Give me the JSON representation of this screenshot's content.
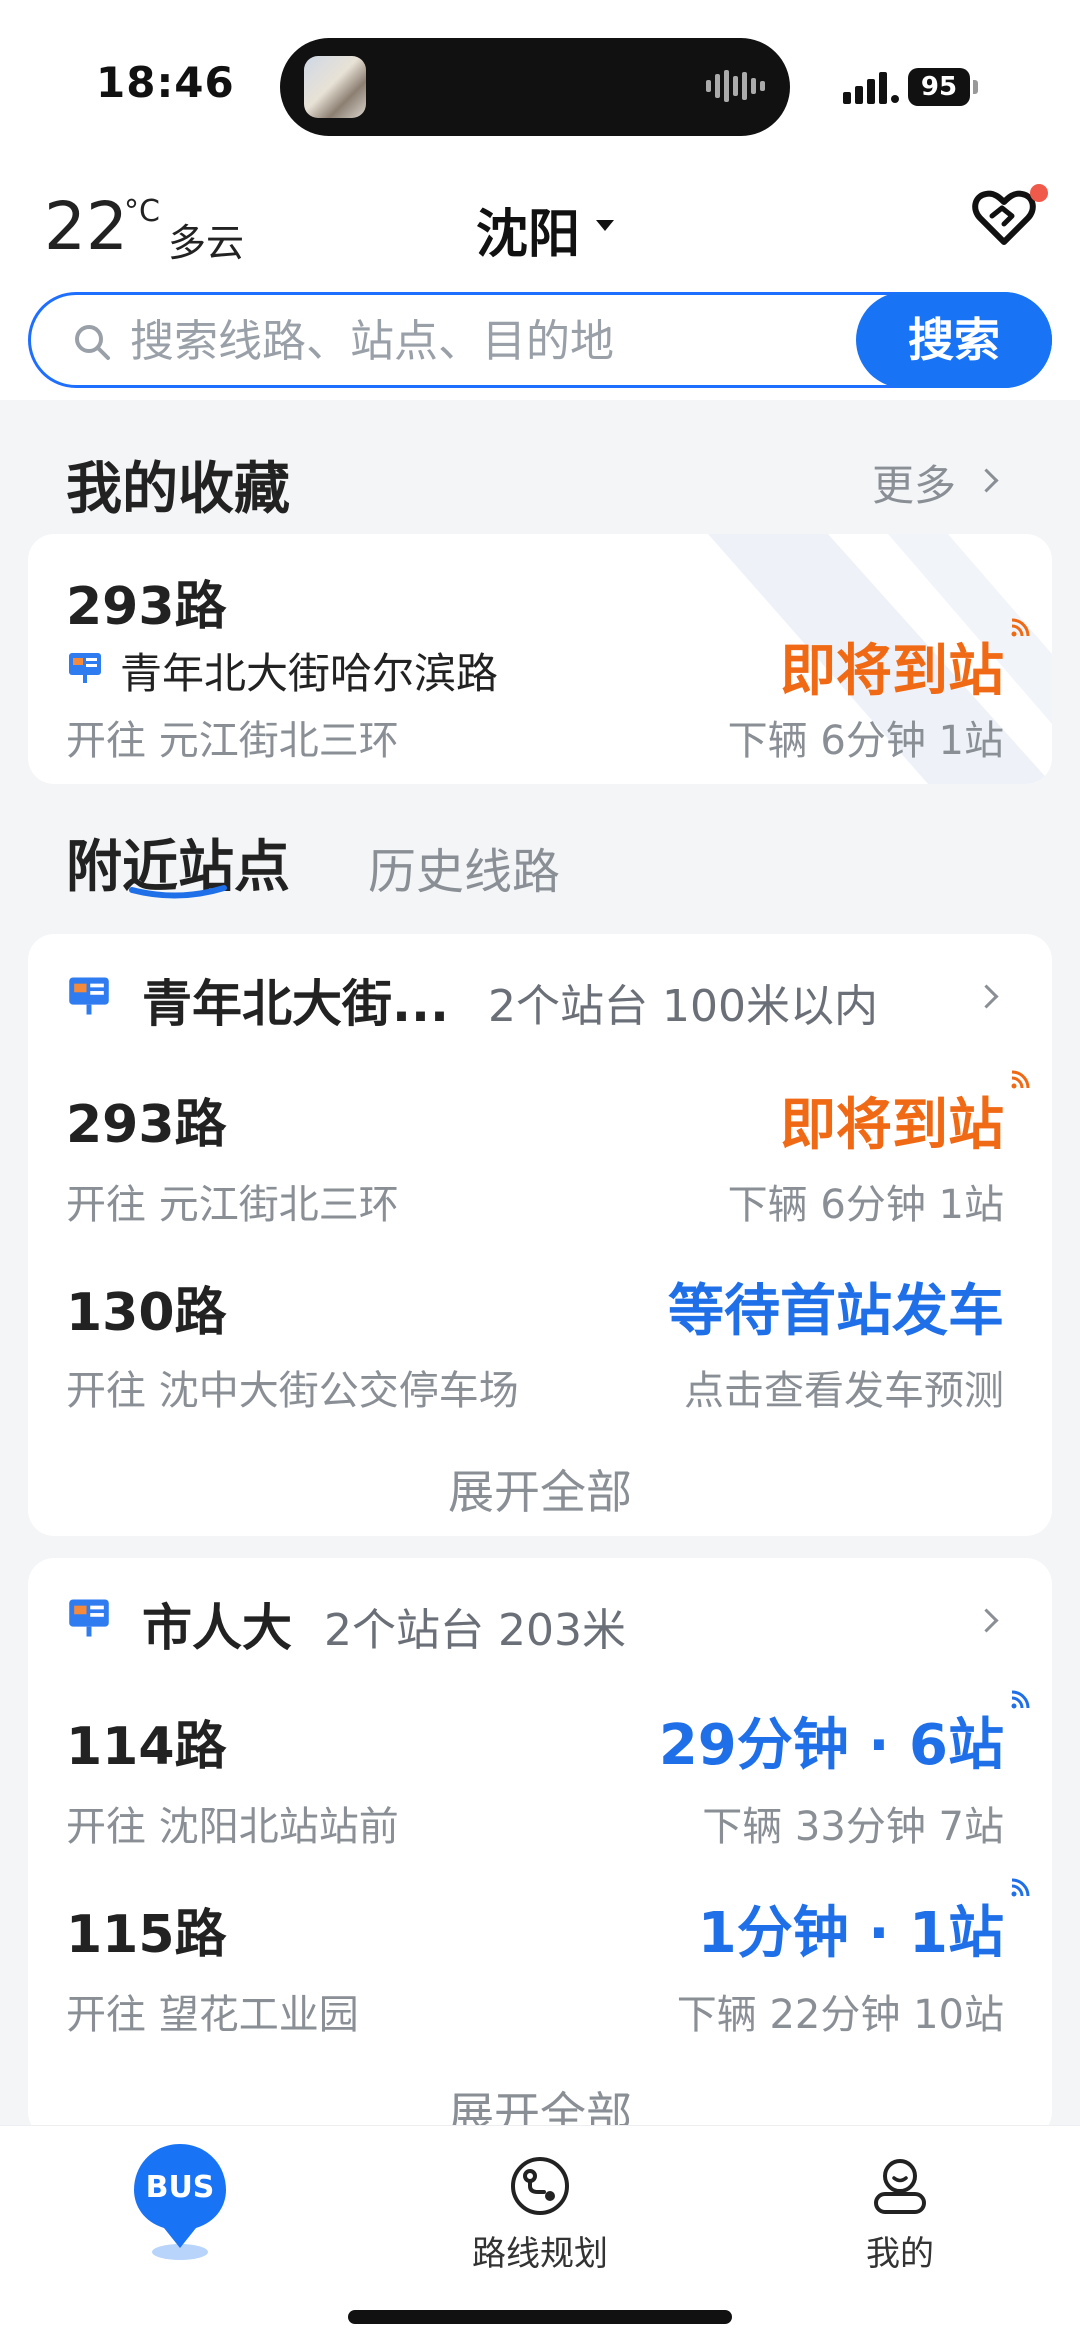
{
  "status_bar": {
    "time": "18:46",
    "battery": "95"
  },
  "header": {
    "temperature": "22",
    "temp_unit": "°C",
    "weather": "多云",
    "city": "沈阳"
  },
  "search": {
    "placeholder": "搜索线路、站点、目的地",
    "button": "搜索"
  },
  "favorites": {
    "title": "我的收藏",
    "more": "更多",
    "item": {
      "route": "293路",
      "stop": "青年北大街哈尔滨路",
      "direction": "开往 元江街北三环",
      "status": "即将到站",
      "next": "下辆 6分钟 1站"
    }
  },
  "tabs": {
    "active": "附近站点",
    "inactive": "历史线路"
  },
  "nearby": [
    {
      "stop": "青年北大街...",
      "meta": "2个站台 100米以内",
      "routes": [
        {
          "route": "293路",
          "direction": "开往 元江街北三环",
          "status": "即将到站",
          "next": "下辆 6分钟 1站"
        },
        {
          "route": "130路",
          "direction": "开往 沈中大街公交停车场",
          "status": "等待首站发车",
          "next": "点击查看发车预测"
        }
      ],
      "expand": "展开全部"
    },
    {
      "stop": "市人大",
      "meta": "2个站台 203米",
      "routes": [
        {
          "route": "114路",
          "direction": "开往 沈阳北站站前",
          "status": "29分钟 · 6站",
          "next": "下辆 33分钟 7站"
        },
        {
          "route": "115路",
          "direction": "开往 望花工业园",
          "status": "1分钟 · 1站",
          "next": "下辆 22分钟 10站"
        }
      ],
      "expand": "展开全部"
    }
  ],
  "bottom_nav": {
    "bus": "BUS",
    "route_plan": "路线规划",
    "mine": "我的"
  },
  "colors": {
    "primary": "#1874f5",
    "orange": "#f06a16",
    "blue_text": "#1f6fe8"
  }
}
